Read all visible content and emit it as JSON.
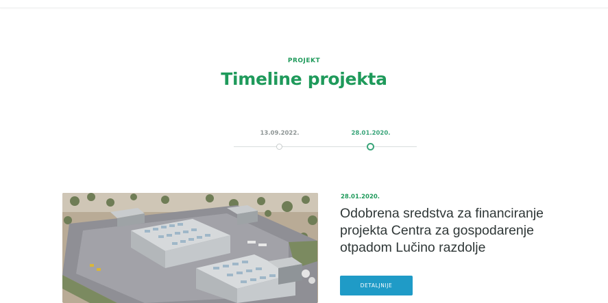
{
  "header": {
    "eyebrow": "PROJEKT",
    "title": "Timeline projekta"
  },
  "timeline": {
    "items": [
      {
        "date": "13.09.2022.",
        "active": false
      },
      {
        "date": "28.01.2020.",
        "active": true
      }
    ]
  },
  "entry": {
    "date": "28.01.2020.",
    "title": "Odobrena sredstva za financiranje projekta Centra za gospodarenje otpadom Lučino razdolje",
    "button_label": "DETALJNIJE",
    "image_alt": "Aerial rendering of waste management center buildings"
  },
  "colors": {
    "brand_green": "#1f9a5b",
    "timeline_active": "#3aa57a",
    "button_blue": "#1f9bc7",
    "text_dark": "#2f3737"
  }
}
